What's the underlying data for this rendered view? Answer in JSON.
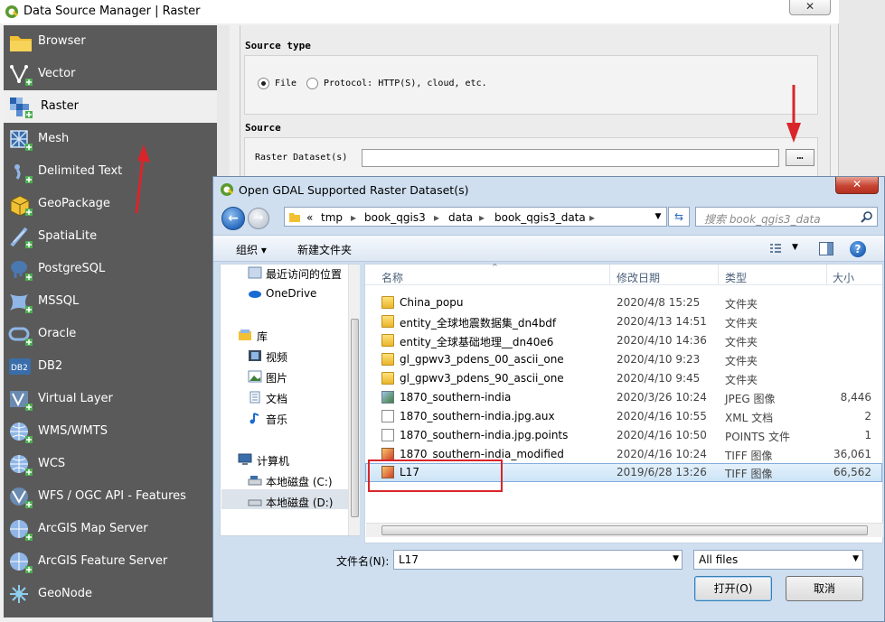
{
  "dsm": {
    "title": "Data Source Manager | Raster",
    "close_label": "✕",
    "sidebar": [
      {
        "label": "Browser",
        "icon": "folder-icon"
      },
      {
        "label": "Vector",
        "icon": "vector-icon"
      },
      {
        "label": "Raster",
        "icon": "raster-icon",
        "active": true
      },
      {
        "label": "Mesh",
        "icon": "mesh-icon"
      },
      {
        "label": "Delimited Text",
        "icon": "delimited-text-icon"
      },
      {
        "label": "GeoPackage",
        "icon": "geopackage-icon"
      },
      {
        "label": "SpatiaLite",
        "icon": "spatialite-icon"
      },
      {
        "label": "PostgreSQL",
        "icon": "postgresql-icon"
      },
      {
        "label": "MSSQL",
        "icon": "mssql-icon"
      },
      {
        "label": "Oracle",
        "icon": "oracle-icon"
      },
      {
        "label": "DB2",
        "icon": "db2-icon"
      },
      {
        "label": "Virtual Layer",
        "icon": "virtual-layer-icon"
      },
      {
        "label": "WMS/WMTS",
        "icon": "wms-icon"
      },
      {
        "label": "WCS",
        "icon": "wcs-icon"
      },
      {
        "label": "WFS / OGC API - Features",
        "icon": "wfs-icon"
      },
      {
        "label": "ArcGIS Map Server",
        "icon": "arcgis-map-icon"
      },
      {
        "label": "ArcGIS Feature Server",
        "icon": "arcgis-feature-icon"
      },
      {
        "label": "GeoNode",
        "icon": "geonode-icon"
      }
    ],
    "source_type": {
      "title": "Source type",
      "file_label": "File",
      "protocol_label": "Protocol: HTTP(S), cloud, etc."
    },
    "source": {
      "title": "Source",
      "dataset_label": "Raster Dataset(s)",
      "dataset_value": "",
      "browse_label": "…"
    }
  },
  "dialog": {
    "title": "Open GDAL Supported Raster Dataset(s)",
    "close_label": "✕",
    "breadcrumb": [
      "«",
      "tmp",
      "book_qgis3",
      "data",
      "book_qgis3_data"
    ],
    "search_placeholder": "搜索 book_qgis3_data",
    "toolbar": {
      "organize": "组织 ▾",
      "new_folder": "新建文件夹"
    },
    "nav": [
      {
        "label": "最近访问的位置",
        "icon": "recent-places-icon"
      },
      {
        "label": "OneDrive",
        "icon": "onedrive-icon"
      },
      {
        "label": "库",
        "icon": "library-icon"
      },
      {
        "label": "视频",
        "icon": "video-icon"
      },
      {
        "label": "图片",
        "icon": "pictures-icon"
      },
      {
        "label": "文档",
        "icon": "documents-icon"
      },
      {
        "label": "音乐",
        "icon": "music-icon"
      },
      {
        "label": "计算机",
        "icon": "computer-icon"
      },
      {
        "label": "本地磁盘 (C:)",
        "icon": "drive-icon"
      },
      {
        "label": "本地磁盘 (D:)",
        "icon": "drive-icon",
        "selected": true
      }
    ],
    "columns": {
      "name": "名称",
      "date": "修改日期",
      "type": "类型",
      "size": "大小"
    },
    "files": [
      {
        "name": "China_popu",
        "date": "2020/4/8 15:25",
        "type": "文件夹",
        "size": "",
        "kind": "folder"
      },
      {
        "name": "entity_全球地震数据集_dn4bdf",
        "date": "2020/4/13 14:51",
        "type": "文件夹",
        "size": "",
        "kind": "folder"
      },
      {
        "name": "entity_全球基础地理__dn40e6",
        "date": "2020/4/10 14:36",
        "type": "文件夹",
        "size": "",
        "kind": "folder"
      },
      {
        "name": "gl_gpwv3_pdens_00_ascii_one",
        "date": "2020/4/10 9:23",
        "type": "文件夹",
        "size": "",
        "kind": "folder"
      },
      {
        "name": "gl_gpwv3_pdens_90_ascii_one",
        "date": "2020/4/10 9:45",
        "type": "文件夹",
        "size": "",
        "kind": "folder"
      },
      {
        "name": "1870_southern-india",
        "date": "2020/3/26 10:24",
        "type": "JPEG 图像",
        "size": "8,446",
        "kind": "image"
      },
      {
        "name": "1870_southern-india.jpg.aux",
        "date": "2020/4/16 10:55",
        "type": "XML 文档",
        "size": "2",
        "kind": "doc"
      },
      {
        "name": "1870_southern-india.jpg.points",
        "date": "2020/4/16 10:50",
        "type": "POINTS 文件",
        "size": "1",
        "kind": "doc"
      },
      {
        "name": "1870_southern-india_modified",
        "date": "2020/4/16 10:24",
        "type": "TIFF 图像",
        "size": "36,061",
        "kind": "tiff"
      },
      {
        "name": "L17",
        "date": "2019/6/28 13:26",
        "type": "TIFF 图像",
        "size": "66,562",
        "kind": "tiff",
        "selected": true
      }
    ],
    "filename_label": "文件名(N):",
    "filename_value": "L17",
    "filter_value": "All files",
    "open_label": "打开(O)",
    "cancel_label": "取消"
  },
  "colors": {
    "sidebar_bg": "#5a5a5a",
    "annotation_red": "#d9252a",
    "dialog_frame": "#cfdff0",
    "selection": "#cce4f7"
  }
}
